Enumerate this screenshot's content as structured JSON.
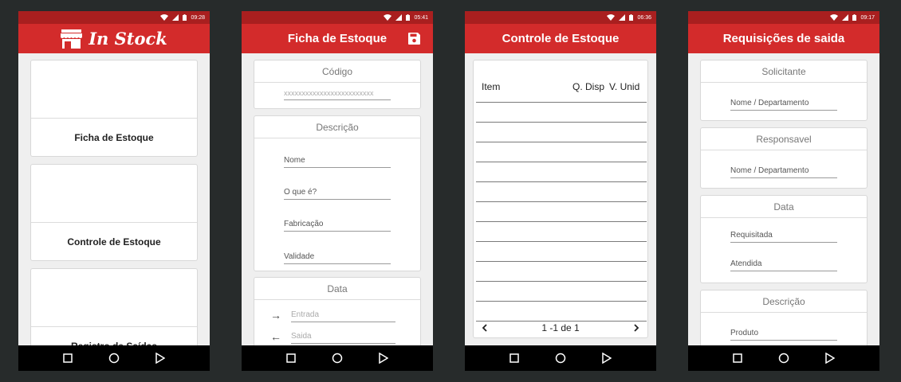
{
  "status_times": [
    "09:28",
    "05:41",
    "06:36",
    "09:17"
  ],
  "screen1": {
    "app_title": "In Stock",
    "menu": [
      "Ficha de Estoque",
      "Controle de Estoque",
      "Registro de Saídas"
    ]
  },
  "screen2": {
    "title": "Ficha de Estoque",
    "codigo": {
      "header": "Código",
      "placeholder": "xxxxxxxxxxxxxxxxxxxxxxxxx"
    },
    "descricao": {
      "header": "Descrição",
      "fields": [
        "Nome",
        "O que é?",
        "Fabricação",
        "Validade"
      ]
    },
    "data": {
      "header": "Data",
      "entrada": "Entrada",
      "saida": "Saida"
    }
  },
  "screen3": {
    "title": "Controle de Estoque",
    "columns": [
      "Item",
      "Q. Disp",
      "V. Unid"
    ],
    "pagination": "1 -1 de 1"
  },
  "screen4": {
    "title": "Requisições de saida",
    "solicitante": {
      "header": "Solicitante",
      "field": "Nome / Departamento"
    },
    "responsavel": {
      "header": "Responsavel",
      "field": "Nome / Departamento"
    },
    "data": {
      "header": "Data",
      "fields": [
        "Requisitada",
        "Atendida"
      ]
    },
    "descricao": {
      "header": "Descrição",
      "field": "Produto"
    }
  },
  "colors": {
    "appbar": "#d32b2b",
    "statusbar": "#a91f1f",
    "background": "#efefef",
    "frame": "#272b2b"
  }
}
